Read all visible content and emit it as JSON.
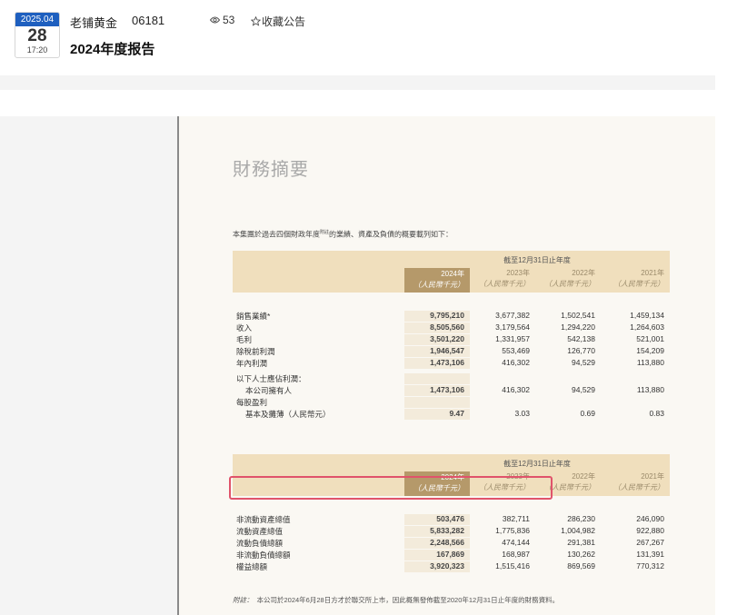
{
  "header": {
    "date_year_month": "2025.04",
    "date_day": "28",
    "date_time": "17:20",
    "company_name": "老铺黄金",
    "stock_code": "06181",
    "view_count": "53",
    "favorite_label": "收藏公告",
    "report_title": "2024年度报告",
    "icons": {
      "views": "eye-icon",
      "favorite": "star-icon"
    },
    "accent_color": "#1e5fbf"
  },
  "document": {
    "page_title": "財務摘要",
    "intro": "本集團於過去四個財政年度",
    "intro_sup": "附註",
    "intro_tail": "的業績、資產及負債的概要載列如下：",
    "period_header": "截至12月31日止年度",
    "unit": "（人民幣千元）",
    "years": [
      "2024年",
      "2023年",
      "2022年",
      "2021年"
    ],
    "table1": {
      "rows": [
        {
          "label": "銷售業績*",
          "values": [
            "9,795,210",
            "3,677,382",
            "1,502,541",
            "1,459,134"
          ]
        },
        {
          "label": "收入",
          "values": [
            "8,505,560",
            "3,179,564",
            "1,294,220",
            "1,264,603"
          ]
        },
        {
          "label": "毛利",
          "values": [
            "3,501,220",
            "1,331,957",
            "542,138",
            "521,001"
          ]
        },
        {
          "label": "除稅前利潤",
          "values": [
            "1,946,547",
            "553,469",
            "126,770",
            "154,209"
          ]
        },
        {
          "label": "年內利潤",
          "values": [
            "1,473,106",
            "416,302",
            "94,529",
            "113,880"
          ]
        },
        {
          "label": "以下人士應佔利潤：",
          "values": [
            "",
            "",
            "",
            ""
          ]
        },
        {
          "label": "本公司擁有人",
          "values": [
            "1,473,106",
            "416,302",
            "94,529",
            "113,880"
          ]
        },
        {
          "label": "每股盈利",
          "values": [
            "",
            "",
            "",
            ""
          ]
        },
        {
          "label": "基本及攤薄（人民幣元）",
          "values": [
            "9.47",
            "3.03",
            "0.69",
            "0.83"
          ]
        }
      ]
    },
    "table2": {
      "rows": [
        {
          "label": "非流動資產總值",
          "values": [
            "503,476",
            "382,711",
            "286,230",
            "246,090"
          ]
        },
        {
          "label": "流動資產總值",
          "values": [
            "5,833,282",
            "1,775,836",
            "1,004,982",
            "922,880"
          ]
        },
        {
          "label": "流動負債總額",
          "values": [
            "2,248,566",
            "474,144",
            "291,381",
            "267,267"
          ]
        },
        {
          "label": "非流動負債總額",
          "values": [
            "167,869",
            "168,987",
            "130,262",
            "131,391"
          ]
        },
        {
          "label": "權益總額",
          "values": [
            "3,920,323",
            "1,515,416",
            "869,569",
            "770,312"
          ]
        }
      ]
    },
    "footnote_label": "附註：",
    "footnote_text": "本公司於2024年6月28日方才於聯交所上市，因此概無發佈截至2020年12月31日止年度的財務資料。",
    "highlight_color": "#e0536b"
  }
}
